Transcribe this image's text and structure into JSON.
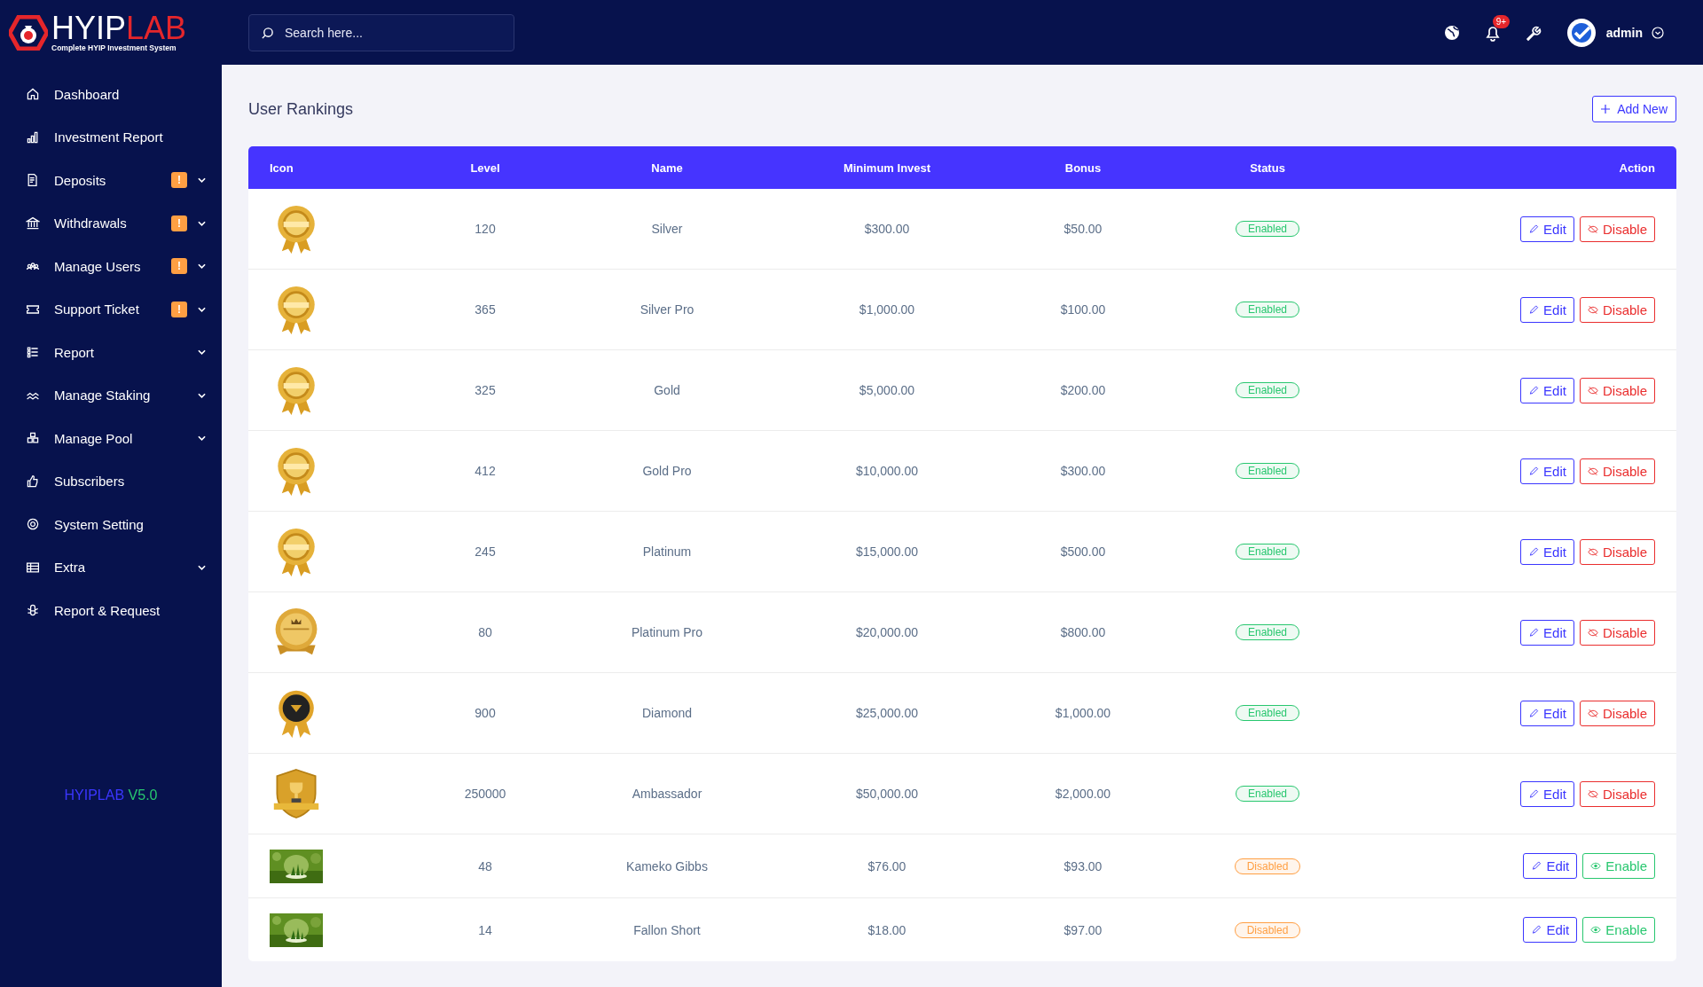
{
  "logo": {
    "name_main": "HYIP",
    "name_accent": "LAB",
    "tagline": "Complete HYIP Investment System"
  },
  "sidebar": {
    "items": [
      {
        "label": "Dashboard",
        "submenu": false
      },
      {
        "label": "Investment Report",
        "submenu": false
      },
      {
        "label": "Deposits",
        "alert": "!",
        "submenu": true
      },
      {
        "label": "Withdrawals",
        "alert": "!",
        "submenu": true
      },
      {
        "label": "Manage Users",
        "alert": "!",
        "submenu": true
      },
      {
        "label": "Support Ticket",
        "alert": "!",
        "submenu": true
      },
      {
        "label": "Report",
        "submenu": true
      },
      {
        "label": "Manage Staking",
        "submenu": true
      },
      {
        "label": "Manage Pool",
        "submenu": true
      },
      {
        "label": "Subscribers",
        "submenu": false
      },
      {
        "label": "System Setting",
        "submenu": false
      },
      {
        "label": "Extra",
        "submenu": true
      },
      {
        "label": "Report & Request",
        "submenu": false
      }
    ],
    "version": {
      "name": "HYIPLAB",
      "number": "V5.0"
    }
  },
  "topbar": {
    "search": {
      "placeholder": "Search here..."
    },
    "notification_count": "9+",
    "user": "admin"
  },
  "page": {
    "title": "User Rankings",
    "add_button": "Add New"
  },
  "table": {
    "columns": [
      "Icon",
      "Level",
      "Name",
      "Minimum Invest",
      "Bonus",
      "Status",
      "Action"
    ],
    "rows": [
      {
        "icon": {
          "kind": "medal"
        },
        "level": "120",
        "name": "Silver",
        "minimum_invest": "$300.00",
        "bonus": "$50.00",
        "status": "Enabled",
        "enabled": true,
        "edit": "Edit",
        "toggle": "Disable"
      },
      {
        "icon": {
          "kind": "medal"
        },
        "level": "365",
        "name": "Silver Pro",
        "minimum_invest": "$1,000.00",
        "bonus": "$100.00",
        "status": "Enabled",
        "enabled": true,
        "edit": "Edit",
        "toggle": "Disable"
      },
      {
        "icon": {
          "kind": "medal"
        },
        "level": "325",
        "name": "Gold",
        "minimum_invest": "$5,000.00",
        "bonus": "$200.00",
        "status": "Enabled",
        "enabled": true,
        "edit": "Edit",
        "toggle": "Disable"
      },
      {
        "icon": {
          "kind": "medal"
        },
        "level": "412",
        "name": "Gold Pro",
        "minimum_invest": "$10,000.00",
        "bonus": "$300.00",
        "status": "Enabled",
        "enabled": true,
        "edit": "Edit",
        "toggle": "Disable"
      },
      {
        "icon": {
          "kind": "medal"
        },
        "level": "245",
        "name": "Platinum",
        "minimum_invest": "$15,000.00",
        "bonus": "$500.00",
        "status": "Enabled",
        "enabled": true,
        "edit": "Edit",
        "toggle": "Disable"
      },
      {
        "icon": {
          "kind": "seal"
        },
        "level": "80",
        "name": "Platinum Pro",
        "minimum_invest": "$20,000.00",
        "bonus": "$800.00",
        "status": "Enabled",
        "enabled": true,
        "edit": "Edit",
        "toggle": "Disable"
      },
      {
        "icon": {
          "kind": "dark-medal"
        },
        "level": "900",
        "name": "Diamond",
        "minimum_invest": "$25,000.00",
        "bonus": "$1,000.00",
        "status": "Enabled",
        "enabled": true,
        "edit": "Edit",
        "toggle": "Disable"
      },
      {
        "icon": {
          "kind": "shield"
        },
        "level": "250000",
        "name": "Ambassador",
        "minimum_invest": "$50,000.00",
        "bonus": "$2,000.00",
        "status": "Enabled",
        "enabled": true,
        "edit": "Edit",
        "toggle": "Disable"
      },
      {
        "level": "48",
        "name": "Kameko Gibbs",
        "minimum_invest": "$76.00",
        "bonus": "$93.00",
        "status": "Disabled",
        "enabled": false,
        "edit": "Edit",
        "toggle": "Enable"
      },
      {
        "level": "14",
        "name": "Fallon Short",
        "minimum_invest": "$18.00",
        "bonus": "$97.00",
        "status": "Disabled",
        "enabled": false,
        "edit": "Edit",
        "toggle": "Enable"
      }
    ]
  }
}
